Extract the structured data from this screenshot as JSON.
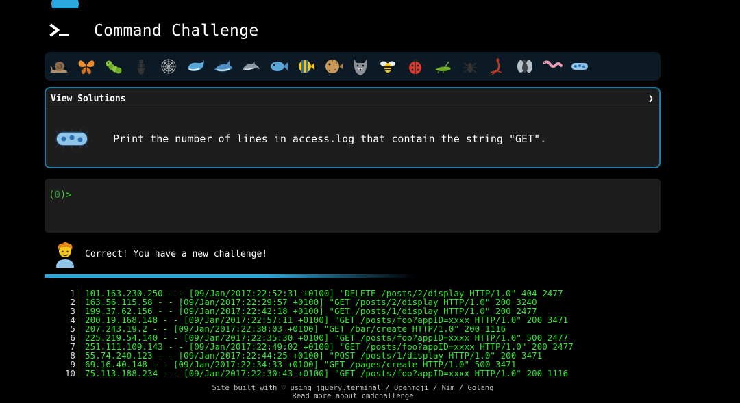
{
  "header": {
    "title": "Command Challenge"
  },
  "emoji_bar": {
    "icons": [
      "snail-icon",
      "butterfly-icon",
      "caterpillar-icon",
      "ant-icon",
      "spider-web-icon",
      "whale-icon",
      "shark-icon",
      "dolphin-icon",
      "fish-icon",
      "tropical-fish-icon",
      "blowfish-icon",
      "wolf-icon",
      "bee-icon",
      "ladybug-icon",
      "cricket-icon",
      "spider-icon",
      "scorpion-icon",
      "fly-icon",
      "worm-icon",
      "microbe-icon"
    ]
  },
  "challenge": {
    "view_solutions_label": "View Solutions",
    "chevron": "❯",
    "text": "Print the number of lines in access.log that contain the string \"GET\"."
  },
  "terminal": {
    "prompt_open": "(",
    "prompt_code": "0",
    "prompt_close": ")>"
  },
  "status": {
    "message": "Correct! You have a new challenge!"
  },
  "progress": {
    "fraction": 0.6
  },
  "log_lines": [
    {
      "n": "1",
      "text": "101.163.230.250 - - [09/Jan/2017:22:52:31 +0100] \"DELETE /posts/2/display HTTP/1.0\" 404 2477"
    },
    {
      "n": "2",
      "text": "163.56.115.58 - - [09/Jan/2017:22:29:57 +0100] \"GET /posts/2/display HTTP/1.0\" 200 3240"
    },
    {
      "n": "3",
      "text": "199.37.62.156 - - [09/Jan/2017:22:42:18 +0100] \"GET /posts/1/display HTTP/1.0\" 200 2477"
    },
    {
      "n": "4",
      "text": "200.19.168.148 - - [09/Jan/2017:22:57:11 +0100] \"GET /posts/foo?appID=xxxx HTTP/1.0\" 200 3471"
    },
    {
      "n": "5",
      "text": "207.243.19.2 - - [09/Jan/2017:22:38:03 +0100] \"GET /bar/create HTTP/1.0\" 200 1116"
    },
    {
      "n": "6",
      "text": "225.219.54.140 - - [09/Jan/2017:22:35:30 +0100] \"GET /posts/foo?appID=xxxx HTTP/1.0\" 500 2477"
    },
    {
      "n": "7",
      "text": "251.111.109.143 - - [09/Jan/2017:22:49:02 +0100] \"GET /posts/foo?appID=xxxx HTTP/1.0\" 200 2477"
    },
    {
      "n": "8",
      "text": "55.74.240.123 - - [09/Jan/2017:22:44:25 +0100] \"POST /posts/1/display HTTP/1.0\" 200 3471"
    },
    {
      "n": "9",
      "text": "69.16.40.148 - - [09/Jan/2017:22:34:33 +0100] \"GET /pages/create HTTP/1.0\" 500 3471"
    },
    {
      "n": "10",
      "text": "75.113.188.234 - - [09/Jan/2017:22:30:43 +0100] \"GET /posts/foo?appID=xxxx HTTP/1.0\" 200 1116"
    }
  ],
  "footer": {
    "line1": "Site built with ♡ using jquery.terminal / Openmoji / Nim / Golang",
    "line2": "Read more about cmdchallenge"
  },
  "colors": {
    "accent": "#29a8e0",
    "terminal_green": "#37d437",
    "log_green": "#2ee62e"
  }
}
